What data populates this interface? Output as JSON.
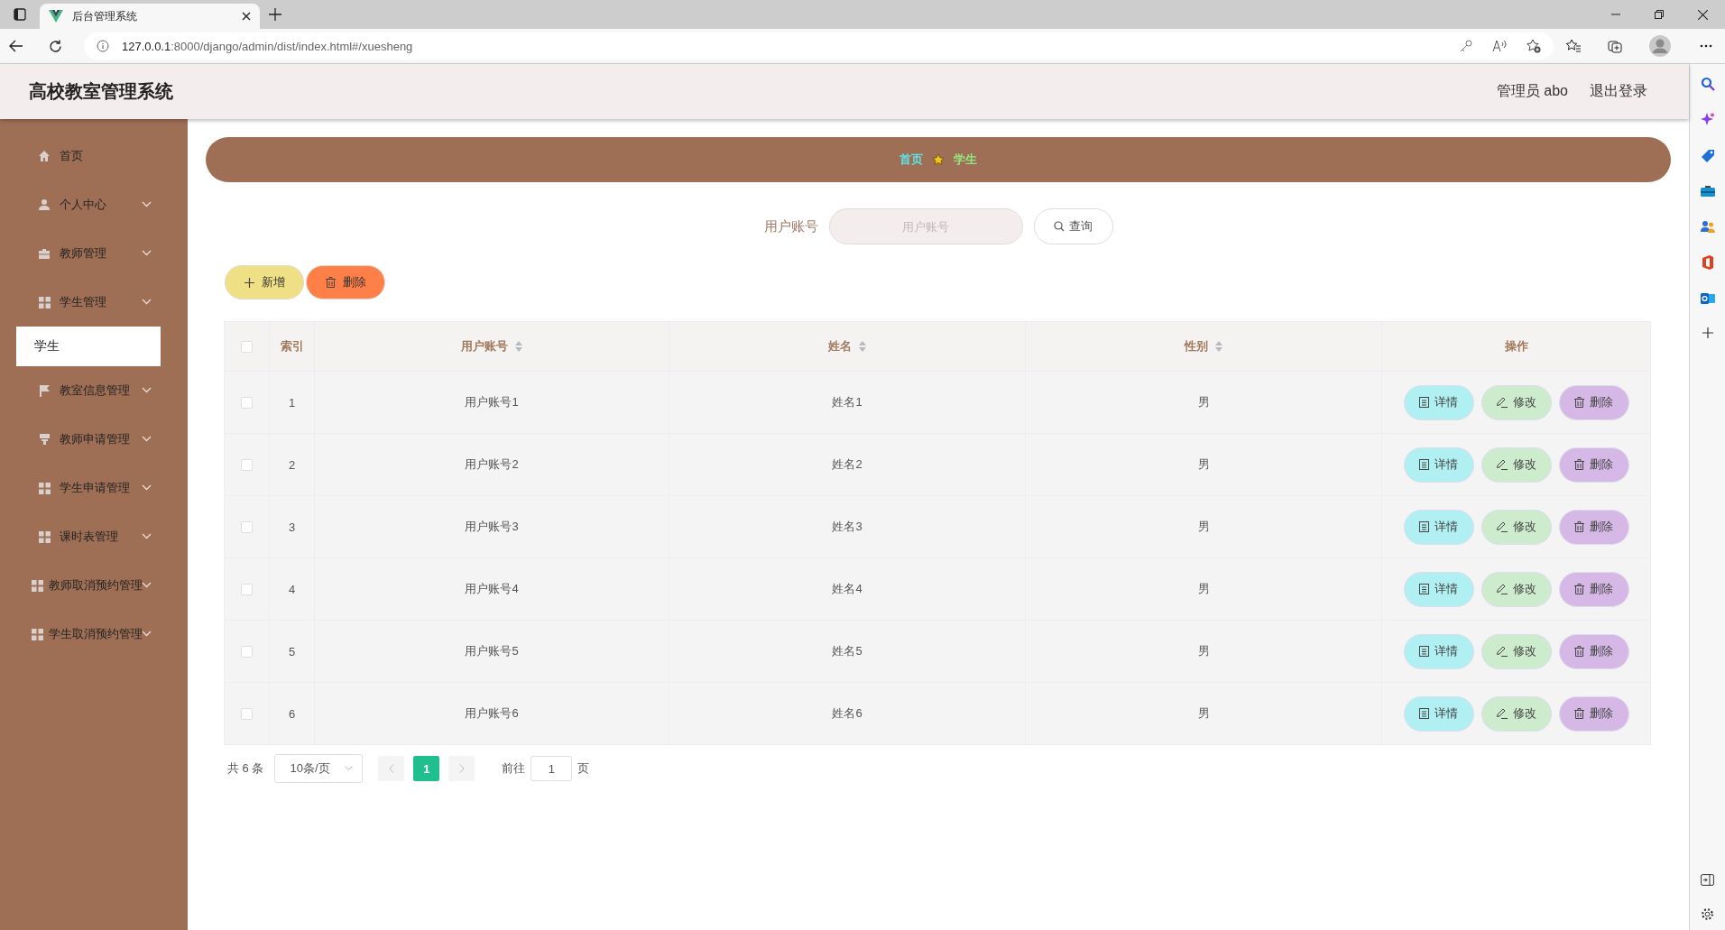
{
  "browser": {
    "tab_title": "后台管理系统",
    "url_host": "127.0.0.1",
    "url_path": ":8000/django/admin/dist/index.html#/xuesheng"
  },
  "header": {
    "title": "高校教室管理系统",
    "user": "管理员 abo",
    "logout": "退出登录"
  },
  "sidebar": {
    "items": [
      {
        "label": "首页",
        "kind": "home",
        "expandable": false,
        "selected": false
      },
      {
        "label": "个人中心",
        "kind": "user",
        "expandable": true,
        "selected": false
      },
      {
        "label": "教师管理",
        "kind": "briefcase",
        "expandable": true,
        "selected": false
      },
      {
        "label": "学生管理",
        "kind": "grid",
        "expandable": true,
        "selected": false,
        "children": [
          {
            "label": "学生",
            "selected": true
          }
        ]
      },
      {
        "label": "教室信息管理",
        "kind": "flag",
        "expandable": true,
        "selected": false
      },
      {
        "label": "教师申请管理",
        "kind": "stamp",
        "expandable": true,
        "selected": false
      },
      {
        "label": "学生申请管理",
        "kind": "grid",
        "expandable": true,
        "selected": false
      },
      {
        "label": "课时表管理",
        "kind": "grid",
        "expandable": true,
        "selected": false
      },
      {
        "label": "教师取消预约管理",
        "kind": "grid",
        "expandable": true,
        "selected": false
      },
      {
        "label": "学生取消预约管理",
        "kind": "grid",
        "expandable": true,
        "selected": false
      }
    ]
  },
  "breadcrumb": [
    {
      "label": "首页",
      "color": "#5ee3ea"
    },
    {
      "label": "学生",
      "color": "#93e67f"
    }
  ],
  "search": {
    "label": "用户账号",
    "placeholder": "用户账号",
    "button": "查询"
  },
  "actions": [
    {
      "label": "新增",
      "kind": "add"
    },
    {
      "label": "删除",
      "kind": "delete"
    }
  ],
  "table": {
    "select_all": false,
    "columns": [
      {
        "label": "索引",
        "sortable": false
      },
      {
        "label": "用户账号",
        "sortable": true
      },
      {
        "label": "姓名",
        "sortable": true
      },
      {
        "label": "性别",
        "sortable": true
      },
      {
        "label": "操作",
        "sortable": false
      }
    ],
    "rows": [
      {
        "selected": false,
        "cells": [
          "1",
          "用户账号1",
          "姓名1",
          "男"
        ],
        "actions": [
          {
            "label": "详情",
            "kind": "detail"
          },
          {
            "label": "修改",
            "kind": "edit"
          },
          {
            "label": "删除",
            "kind": "delete"
          }
        ]
      },
      {
        "selected": false,
        "cells": [
          "2",
          "用户账号2",
          "姓名2",
          "男"
        ],
        "actions": [
          {
            "label": "详情",
            "kind": "detail"
          },
          {
            "label": "修改",
            "kind": "edit"
          },
          {
            "label": "删除",
            "kind": "delete"
          }
        ]
      },
      {
        "selected": false,
        "cells": [
          "3",
          "用户账号3",
          "姓名3",
          "男"
        ],
        "actions": [
          {
            "label": "详情",
            "kind": "detail"
          },
          {
            "label": "修改",
            "kind": "edit"
          },
          {
            "label": "删除",
            "kind": "delete"
          }
        ]
      },
      {
        "selected": false,
        "cells": [
          "4",
          "用户账号4",
          "姓名4",
          "男"
        ],
        "actions": [
          {
            "label": "详情",
            "kind": "detail"
          },
          {
            "label": "修改",
            "kind": "edit"
          },
          {
            "label": "删除",
            "kind": "delete"
          }
        ]
      },
      {
        "selected": false,
        "cells": [
          "5",
          "用户账号5",
          "姓名5",
          "男"
        ],
        "actions": [
          {
            "label": "详情",
            "kind": "detail"
          },
          {
            "label": "修改",
            "kind": "edit"
          },
          {
            "label": "删除",
            "kind": "delete"
          }
        ]
      },
      {
        "selected": false,
        "cells": [
          "6",
          "用户账号6",
          "姓名6",
          "男"
        ],
        "actions": [
          {
            "label": "详情",
            "kind": "detail"
          },
          {
            "label": "修改",
            "kind": "edit"
          },
          {
            "label": "删除",
            "kind": "delete"
          }
        ]
      }
    ]
  },
  "pagination": {
    "total": "共 6 条",
    "page_size": "10条/页",
    "pages": [
      {
        "label": "1",
        "selected": true
      }
    ],
    "goto_label": "前往",
    "goto_value": "1",
    "goto_suffix": "页"
  }
}
